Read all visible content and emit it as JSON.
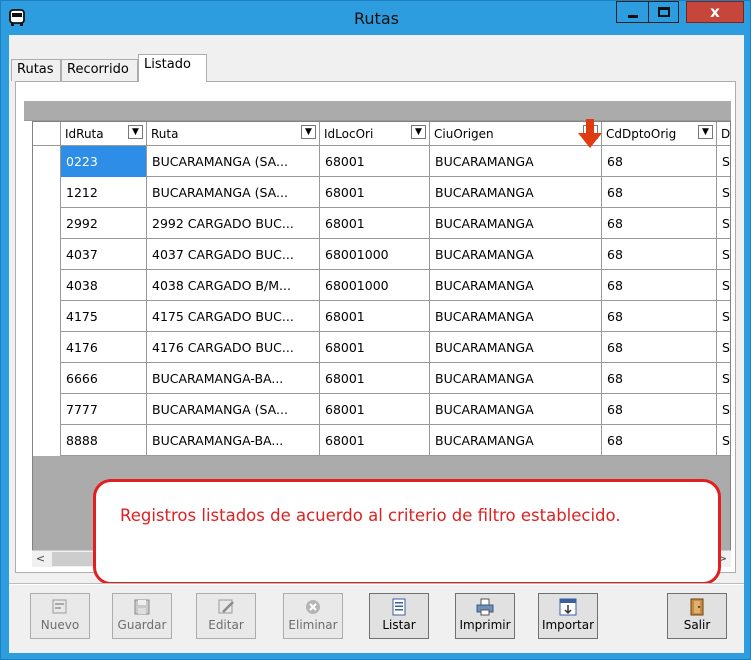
{
  "window": {
    "title": "Rutas",
    "close_glyph": "x"
  },
  "tabs": [
    {
      "label": "Rutas"
    },
    {
      "label": "Recorrido"
    },
    {
      "label": "Listado",
      "active": true
    }
  ],
  "grid": {
    "columns": [
      "IdRuta",
      "Ruta",
      "IdLocOri",
      "CiuOrigen",
      "CdDptoOrig",
      "Dp"
    ],
    "filter_icon": "funnel-icon",
    "rows": [
      [
        "0223",
        "BUCARAMANGA (SA...",
        "68001",
        "BUCARAMANGA",
        "68",
        "SAI"
      ],
      [
        "1212",
        "BUCARAMANGA (SA...",
        "68001",
        "BUCARAMANGA",
        "68",
        "SAI"
      ],
      [
        "2992",
        "2992 CARGADO BUC...",
        "68001",
        "BUCARAMANGA",
        "68",
        "SAI"
      ],
      [
        "4037",
        "4037 CARGADO BUC...",
        "68001000",
        "BUCARAMANGA",
        "68",
        "SAI"
      ],
      [
        "4038",
        "4038 CARGADO B/M...",
        "68001000",
        "BUCARAMANGA",
        "68",
        "SAI"
      ],
      [
        "4175",
        "4175 CARGADO BUC...",
        "68001",
        "BUCARAMANGA",
        "68",
        "SAI"
      ],
      [
        "4176",
        "4176 CARGADO BUC...",
        "68001",
        "BUCARAMANGA",
        "68",
        "SAI"
      ],
      [
        "6666",
        "BUCARAMANGA-BA...",
        "68001",
        "BUCARAMANGA",
        "68",
        "SAI"
      ],
      [
        "7777",
        "BUCARAMANGA (SA...",
        "68001",
        "BUCARAMANGA",
        "68",
        "SAI"
      ],
      [
        "8888",
        "BUCARAMANGA-BA...",
        "68001",
        "BUCARAMANGA",
        "68",
        "SAI"
      ]
    ],
    "selected_row": 0,
    "scroll": {
      "left_arrow": "<",
      "right_arrow": ">",
      "thumb_grip": "III"
    }
  },
  "callout": {
    "text": "Registros listados de acuerdo al criterio de filtro establecido."
  },
  "toolbar": {
    "nuevo": "Nuevo",
    "guardar": "Guardar",
    "editar": "Editar",
    "eliminar": "Eliminar",
    "listar": "Listar",
    "imprimir": "Imprimir",
    "importar": "Importar",
    "salir": "Salir"
  },
  "colors": {
    "titlebar": "#2e9ddf",
    "close_button": "#c7463c",
    "selection": "#2e8de6",
    "callout_border": "#e02020",
    "arrow": "#e03a10"
  }
}
